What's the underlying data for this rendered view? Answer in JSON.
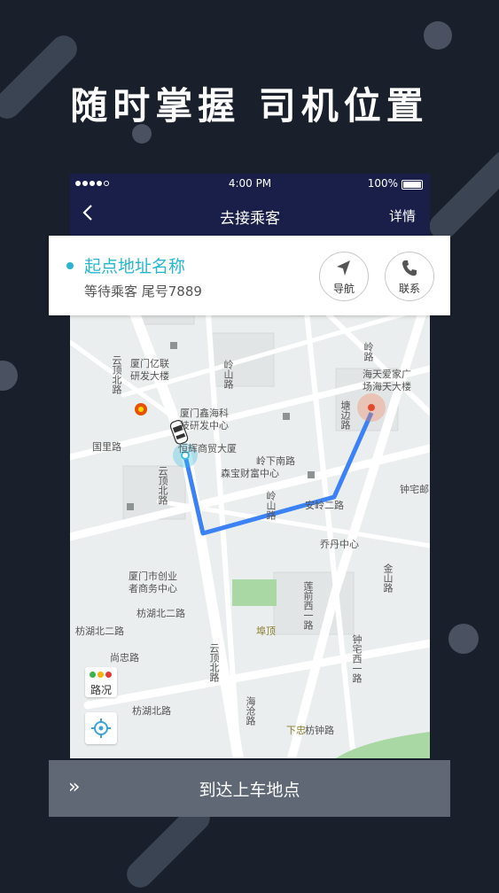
{
  "headline": "随时掌握  司机位置",
  "status_bar": {
    "time": "4:00 PM",
    "battery": "100%"
  },
  "nav": {
    "back_icon": "chevron-left-icon",
    "title": "去接乘客",
    "detail": "详情"
  },
  "pickup": {
    "name": "起点地址名称",
    "status": "等待乘客  尾号7889",
    "navigate_label": "导航",
    "contact_label": "联系"
  },
  "map": {
    "labels": {
      "poi_yilian_1": "厦门亿联",
      "poi_yilian_2": "研发大楼",
      "poi_xinhai_1": "厦门鑫海科",
      "poi_xinhai_2": "技研发中心",
      "poi_henghui": "恒辉商贸大厦",
      "poi_senbao": "森宝财富中心",
      "poi_chuangye_1": "厦门市创业",
      "poi_chuangye_2": "者商务中心",
      "poi_haitian_1": "海天爱家广",
      "poi_haitian_2": "场海天大楼",
      "poi_qiaodan": "乔丹中心",
      "poi_zhongzhai": "钟宅邮",
      "road_ling_xia_nan": "岭下南路",
      "road_anling_2": "安岭二路",
      "road_anling_2b": "安岭二路",
      "road_hangzhou_2": "枋湖北二路",
      "road_hangzhou_2b": "枋湖北二路",
      "road_hangzhou": "枋湖北路",
      "road_shangzhong": "尚忠路",
      "road_fangzhong": "枋钟路",
      "road_guoli": "国里路",
      "road_yundingbei_1": "云顶北路",
      "road_yundingbei_2": "云顶北路",
      "road_yundingbei_3": "云顶北路",
      "road_lingshan": "岭山路",
      "road_jiangshan": "岭山路",
      "road_jinshan": "金山路",
      "road_zhongzhai_xi": "钟宅西一路",
      "road_tandun": "塘边路",
      "road_linglu": "岭路",
      "road_zhuoding": "埠顶",
      "road_xiazhong": "下忠",
      "road_lianqian": "莲前西一路",
      "road_haiyu": "海沧路"
    },
    "traffic_label": "路况",
    "traffic_colors": [
      "#3cb34a",
      "#f5b400",
      "#e53935"
    ],
    "route_color": "#3b82f6"
  },
  "bottom_action": {
    "label": "到达上车地点",
    "arrows": "»"
  }
}
